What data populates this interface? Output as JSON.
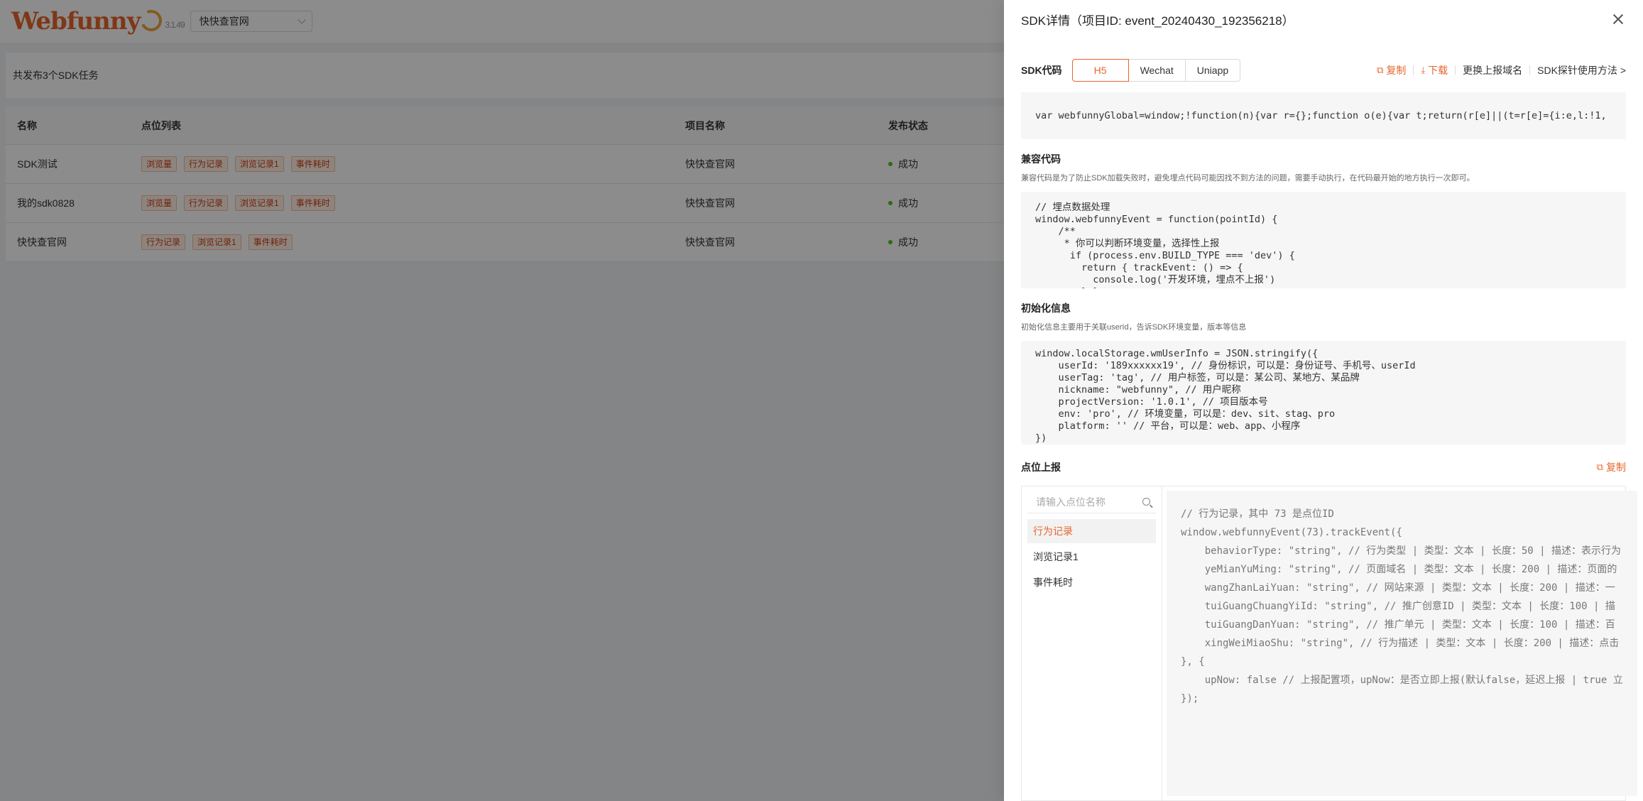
{
  "topbar": {
    "logo_text": "Webfunny",
    "version": "3.1.49",
    "project": "快快查官网"
  },
  "summary": "共发布3个SDK任务",
  "table": {
    "headers": [
      "名称",
      "点位列表",
      "项目名称",
      "发布状态"
    ],
    "rows": [
      {
        "name": "SDK测试",
        "tags": [
          "浏览量",
          "行为记录",
          "浏览记录1",
          "事件耗时"
        ],
        "project": "快快查官网",
        "status": "成功"
      },
      {
        "name": "我的sdk0828",
        "tags": [
          "浏览量",
          "行为记录",
          "浏览记录1",
          "事件耗时"
        ],
        "project": "快快查官网",
        "status": "成功"
      },
      {
        "name": "快快查官网",
        "tags": [
          "行为记录",
          "浏览记录1",
          "事件耗时"
        ],
        "project": "快快查官网",
        "status": "成功"
      }
    ]
  },
  "drawer": {
    "title": "SDK详情（项目ID: event_20240430_192356218）",
    "sdk_label": "SDK代码",
    "tabs": [
      "H5",
      "Wechat",
      "Uniapp"
    ],
    "actions": {
      "copy": "复制",
      "download": "下载",
      "change_domain": "更换上报域名",
      "usage": "SDK探针使用方法 >"
    },
    "sdk_code": "var webfunnyGlobal=window;!function(n){var r={};function o(e){var t;return(r[e]||(t=r[e]={i:e,l:!1,",
    "compat_title": "兼容代码",
    "compat_desc": "兼容代码是为了防止SDK加载失败时，避免埋点代码可能因找不到方法的问题，需要手动执行，在代码最开始的地方执行一次即可。",
    "compat_code": "// 埋点数据处理\nwindow.webfunnyEvent = function(pointId) {\n    /**\n     * 你可以判断环境变量，选择性上报\n      if (process.env.BUILD_TYPE === 'dev') {\n        return { trackEvent: () => {\n          console.log('开发环境，埋点不上报')\n        } }",
    "init_title": "初始化信息",
    "init_desc": "初始化信息主要用于关联userId，告诉SDK环境变量，版本等信息",
    "init_code": "window.localStorage.wmUserInfo = JSON.stringify({\n    userId: '189xxxxxx19', // 身份标识，可以是：身份证号、手机号、userId\n    userTag: 'tag', // 用户标签，可以是：某公司、某地方、某品牌\n    nickname: \"webfunny\", // 用户昵称\n    projectVersion: '1.0.1', // 项目版本号\n    env: 'pro', // 环境变量，可以是：dev、sit、stag、pro\n    platform: '' // 平台，可以是：web、app、小程序\n})",
    "point_title": "点位上报",
    "point_copy": "复制",
    "search_placeholder": "请输入点位名称",
    "points": [
      "行为记录",
      "浏览记录1",
      "事件耗时"
    ],
    "point_code": "// 行为记录，其中 73 是点位ID\nwindow.webfunnyEvent(73).trackEvent({\n    behaviorType: \"string\", // 行为类型 | 类型：文本 | 长度：50 | 描述：表示行为\n    yeMianYuMing: \"string\", // 页面域名 | 类型：文本 | 长度：200 | 描述：页面的\n    wangZhanLaiYuan: \"string\", // 网站来源 | 类型：文本 | 长度：200 | 描述：一\n    tuiGuangChuangYiId: \"string\", // 推广创意ID | 类型：文本 | 长度：100 | 描\n    tuiGuangDanYuan: \"string\", // 推广单元 | 类型：文本 | 长度：100 | 描述：百\n    xingWeiMiaoShu: \"string\", // 行为描述 | 类型：文本 | 长度：200 | 描述：点击\n}, {\n    upNow: false // 上报配置项，upNow：是否立即上报(默认false，延迟上报 | true 立\n});"
  }
}
